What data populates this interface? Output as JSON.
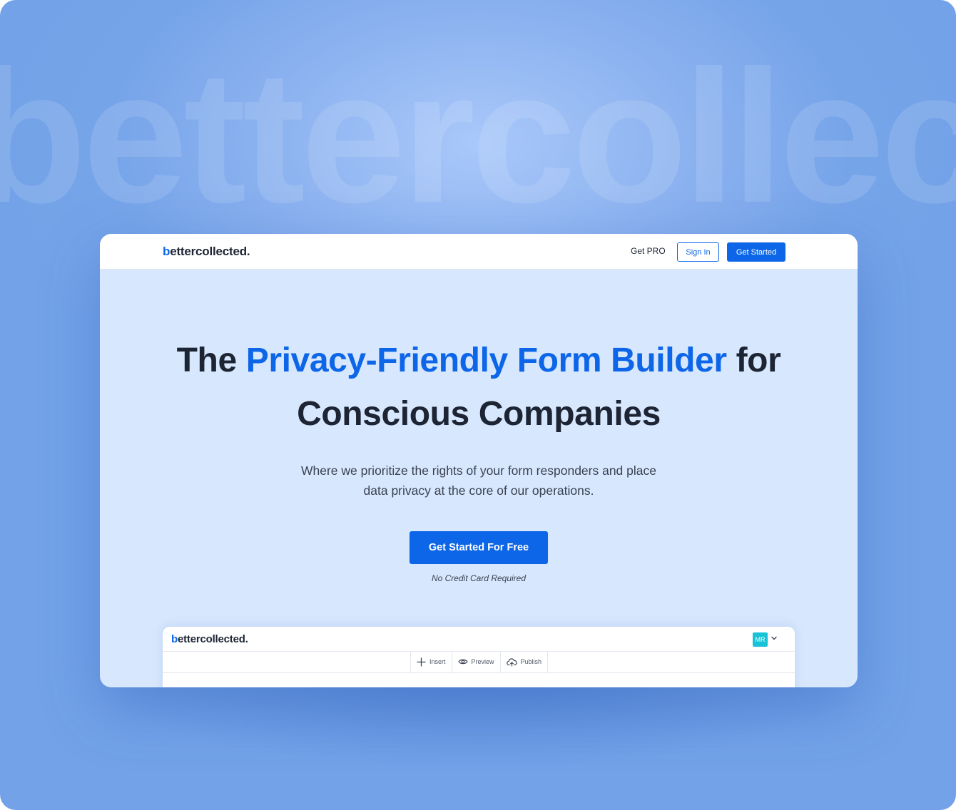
{
  "background": {
    "watermark_text": "bettercollected",
    "colors": {
      "outer": "#73a2e8",
      "glow": "#a9c8fa"
    }
  },
  "navbar": {
    "logo_initial": "b",
    "logo_rest": "ettercollected.",
    "get_pro": "Get PRO",
    "sign_in": "Sign In",
    "get_started": "Get Started"
  },
  "hero": {
    "title_part1": "The ",
    "title_accent": "Privacy-Friendly Form Builder",
    "title_part2": " for",
    "title_line2": "Conscious Companies",
    "subtitle_line1": "Where we prioritize the rights of your form responders and place",
    "subtitle_line2": "data privacy at the core of our operations.",
    "cta": "Get Started For Free",
    "note": "No Credit Card Required"
  },
  "preview": {
    "logo_initial": "b",
    "logo_rest": "ettercollected.",
    "avatar": "MR",
    "toolbar": [
      {
        "label": "Insert",
        "icon": "plus-icon"
      },
      {
        "label": "Preview",
        "icon": "eye-icon"
      },
      {
        "label": "Publish",
        "icon": "cloud-upload-icon"
      }
    ]
  },
  "colors": {
    "accent": "#0d66e8",
    "text": "#1d2433",
    "page_bg": "#d7e7fd"
  }
}
